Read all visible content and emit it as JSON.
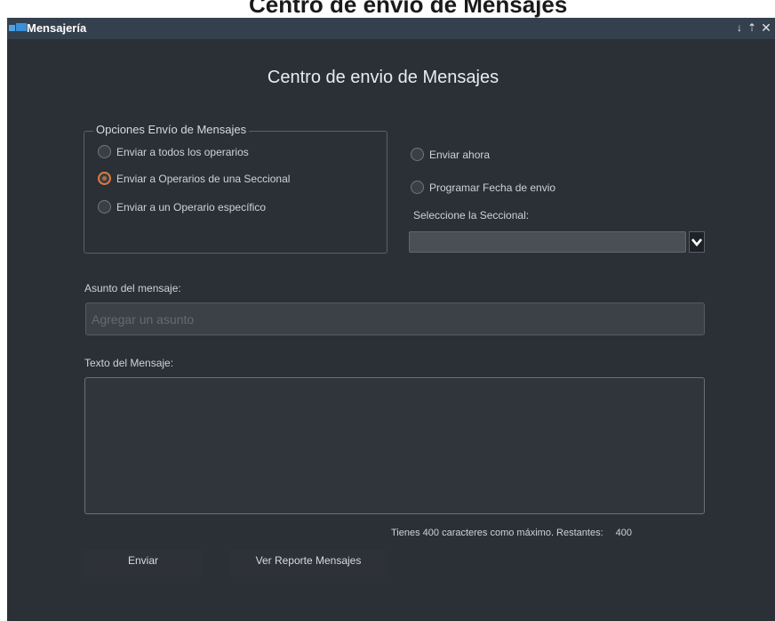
{
  "background": {
    "partial_title": "Centro de envio de Mensajes"
  },
  "window": {
    "title": "Mensajería",
    "controls": {
      "pin": "↓",
      "maximize": "⇡",
      "close": "✕"
    }
  },
  "heading": "Centro de envio de Mensajes",
  "send_options": {
    "legend": "Opciones Envío de Mensajes",
    "options": [
      {
        "label": "Enviar a todos los operarios",
        "selected": false
      },
      {
        "label": "Enviar a Operarios de una Seccional",
        "selected": true
      },
      {
        "label": "Enviar a un Operario específico",
        "selected": false
      }
    ]
  },
  "schedule": {
    "now": "Enviar ahora",
    "program": "Programar Fecha de envio"
  },
  "seccional": {
    "label": "Seleccione la Seccional:",
    "value": ""
  },
  "subject": {
    "label": "Asunto del mensaje:",
    "placeholder": "Agregar un asunto",
    "value": ""
  },
  "message": {
    "label": "Texto del Mensaje:",
    "value": ""
  },
  "counter": {
    "text": "Tienes 400 caracteres como máximo. Restantes:",
    "remaining": "400"
  },
  "buttons": {
    "send": "Enviar",
    "report": "Ver Reporte Mensajes"
  },
  "colors": {
    "window_bg": "#2b2f36",
    "titlebar": "#34404e",
    "accent_radio": "#e07a3e"
  }
}
